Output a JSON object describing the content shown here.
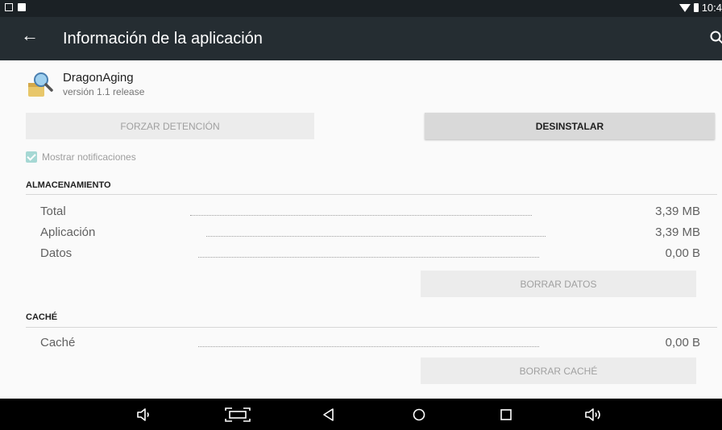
{
  "status_bar": {
    "time": "10:4"
  },
  "app_bar": {
    "title": "Información de la aplicación"
  },
  "app": {
    "name": "DragonAging",
    "version": "versión 1.1 release"
  },
  "buttons": {
    "force_stop": "FORZAR DETENCIÓN",
    "uninstall": "DESINSTALAR"
  },
  "notifications": {
    "label": "Mostrar notificaciones",
    "checked": true
  },
  "storage": {
    "header": "ALMACENAMIENTO",
    "rows": [
      {
        "label": "Total",
        "value": "3,39 MB"
      },
      {
        "label": "Aplicación",
        "value": "3,39 MB"
      },
      {
        "label": "Datos",
        "value": "0,00 B"
      }
    ],
    "clear_button": "BORRAR DATOS"
  },
  "cache": {
    "header": "CACHÉ",
    "rows": [
      {
        "label": "Caché",
        "value": "0,00 B"
      }
    ],
    "clear_button": "BORRAR CACHÉ"
  },
  "colors": {
    "status_bar": "#1b2125",
    "app_bar": "#252d32",
    "checkbox": "#a6d8d4",
    "nav_bar": "#000000"
  },
  "icons": [
    "picture-icon",
    "notification-icon",
    "wifi-icon",
    "battery-icon",
    "back-arrow-icon",
    "search-icon",
    "volume-down-icon",
    "screenshot-icon",
    "back-icon",
    "home-icon",
    "recents-icon",
    "volume-up-icon"
  ]
}
